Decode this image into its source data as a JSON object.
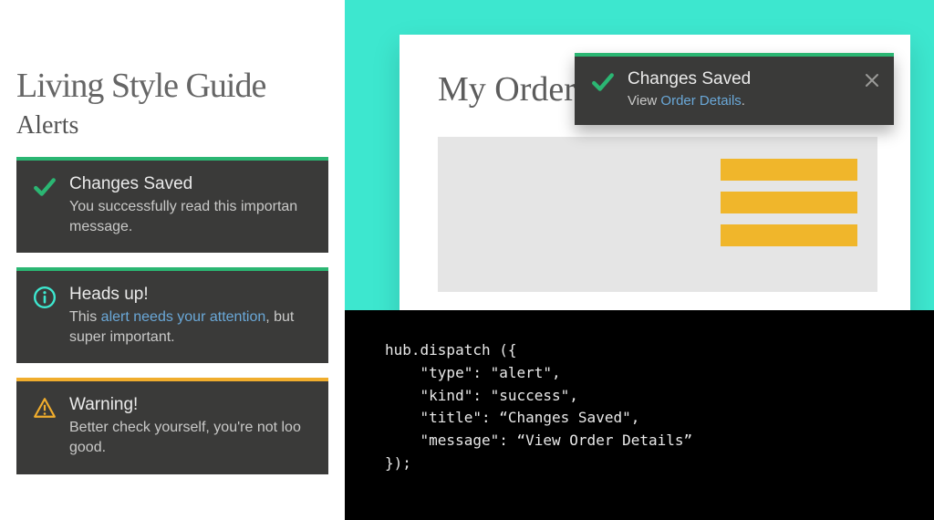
{
  "left": {
    "title": "Living Style Guide",
    "section": "Alerts",
    "alerts": [
      {
        "kind": "success",
        "title": "Changes Saved",
        "body_prefix": "You successfully read this importan",
        "link": "",
        "body_mid": "",
        "body_suffix": "",
        "line2": "message."
      },
      {
        "kind": "info",
        "title": "Heads up!",
        "body_prefix": "This ",
        "link": "alert needs your attention",
        "body_mid": ", but ",
        "body_suffix": "",
        "line2": "super important."
      },
      {
        "kind": "warning",
        "title": "Warning!",
        "body_prefix": "Better check yourself, you're not loo",
        "link": "",
        "body_mid": "",
        "body_suffix": "",
        "line2": "good."
      }
    ]
  },
  "doc": {
    "title": "My Orders"
  },
  "float": {
    "title": "Changes Saved",
    "body_prefix": "View ",
    "link": "Order Details",
    "body_suffix": "."
  },
  "code": "hub.dispatch ({\n    \"type\": \"alert\",\n    \"kind\": \"success\",\n    \"title\": “Changes Saved\",\n    \"message\": “View Order Details”\n});",
  "colors": {
    "success": "#2bb673",
    "info_icon": "#3de7cf",
    "warning": "#f0ad2d",
    "link": "#6aa8d8"
  }
}
